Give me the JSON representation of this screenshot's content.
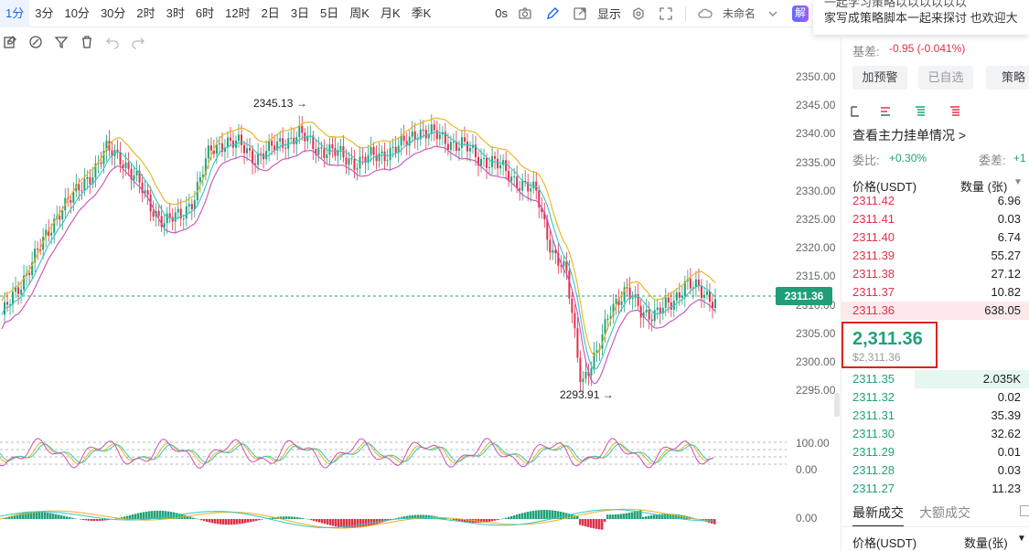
{
  "toolbar": {
    "timeframes": [
      "1分",
      "3分",
      "10分",
      "30分",
      "2时",
      "3时",
      "6时",
      "12时",
      "2日",
      "3日",
      "5日",
      "周K",
      "月K",
      "季K"
    ],
    "active_timeframe": "1分",
    "seconds_label": "0s",
    "display_label": "显示",
    "template_label": "未命名",
    "ai_label": "AI解读"
  },
  "notification": {
    "line1": "一起学习策略以以以以以以",
    "line2": "家写成策略脚本一起来探讨 也欢迎大"
  },
  "chart": {
    "y_ticks": [
      "2350.00",
      "2345.00",
      "2340.00",
      "2335.00",
      "2330.00",
      "2325.00",
      "2320.00",
      "2315.00",
      "2310.00",
      "2305.00",
      "2300.00",
      "2295.00"
    ],
    "current_price_tag": "2311.36",
    "high_annotation": "2345.13 →",
    "low_annotation": "2293.91 →",
    "osc_ticks": [
      "100.00",
      "0.00"
    ],
    "macd_ticks": [
      "0.00"
    ],
    "colors": {
      "up": "#21a27a",
      "down": "#e0314a",
      "ma_yellow": "#e9b21a",
      "ma_cyan": "#35c5c5",
      "ma_magenta": "#c84fb8"
    }
  },
  "chart_data": {
    "type": "line",
    "title": "",
    "ylim": [
      2292,
      2352
    ],
    "series": [
      {
        "values": [
          2308,
          2312,
          2318,
          2322,
          2328,
          2330,
          2334,
          2338,
          2337,
          2333,
          2328,
          2325,
          2326,
          2330,
          2338,
          2340,
          2339,
          2337,
          2338,
          2340,
          2341,
          2339,
          2338,
          2337,
          2336,
          2337,
          2338,
          2339,
          2342,
          2341,
          2340,
          2339,
          2337,
          2336,
          2334,
          2332,
          2330,
          2320,
          2315,
          2296,
          2300,
          2310,
          2312,
          2309,
          2308,
          2310,
          2314,
          2312,
          2311
        ]
      }
    ]
  },
  "right_panel": {
    "basis_label": "基差:",
    "basis_value": "-0.95 (-0.041%)",
    "alert_btn": "加预警",
    "watch_btn": "已自选",
    "strategy_btn": "策略",
    "main_orders_link": "查看主力挂单情况 >",
    "committee_ratio_label": "委比:",
    "committee_ratio_value": "+0.30%",
    "committee_diff_label": "委差:",
    "committee_diff_value": "+1",
    "price_header": "价格(USDT)",
    "qty_header": "数量 (张)",
    "asks": [
      {
        "price": "2311.42",
        "qty": "6.96"
      },
      {
        "price": "2311.41",
        "qty": "0.03"
      },
      {
        "price": "2311.40",
        "qty": "6.74"
      },
      {
        "price": "2311.39",
        "qty": "55.27"
      },
      {
        "price": "2311.38",
        "qty": "27.12"
      },
      {
        "price": "2311.37",
        "qty": "10.82"
      },
      {
        "price": "2311.36",
        "qty": "638.05"
      }
    ],
    "last_price": "2,311.36",
    "last_price_usd": "$2,311.36",
    "bids": [
      {
        "price": "2311.35",
        "qty": "2.035K"
      },
      {
        "price": "2311.32",
        "qty": "0.02"
      },
      {
        "price": "2311.31",
        "qty": "35.39"
      },
      {
        "price": "2311.30",
        "qty": "32.62"
      },
      {
        "price": "2311.29",
        "qty": "0.01"
      },
      {
        "price": "2311.28",
        "qty": "0.03"
      },
      {
        "price": "2311.27",
        "qty": "11.23"
      }
    ],
    "tab_latest": "最新成交",
    "tab_large": "大额成交",
    "trades_price_header": "价格(USDT)",
    "trades_qty_header": "数量(张)"
  }
}
